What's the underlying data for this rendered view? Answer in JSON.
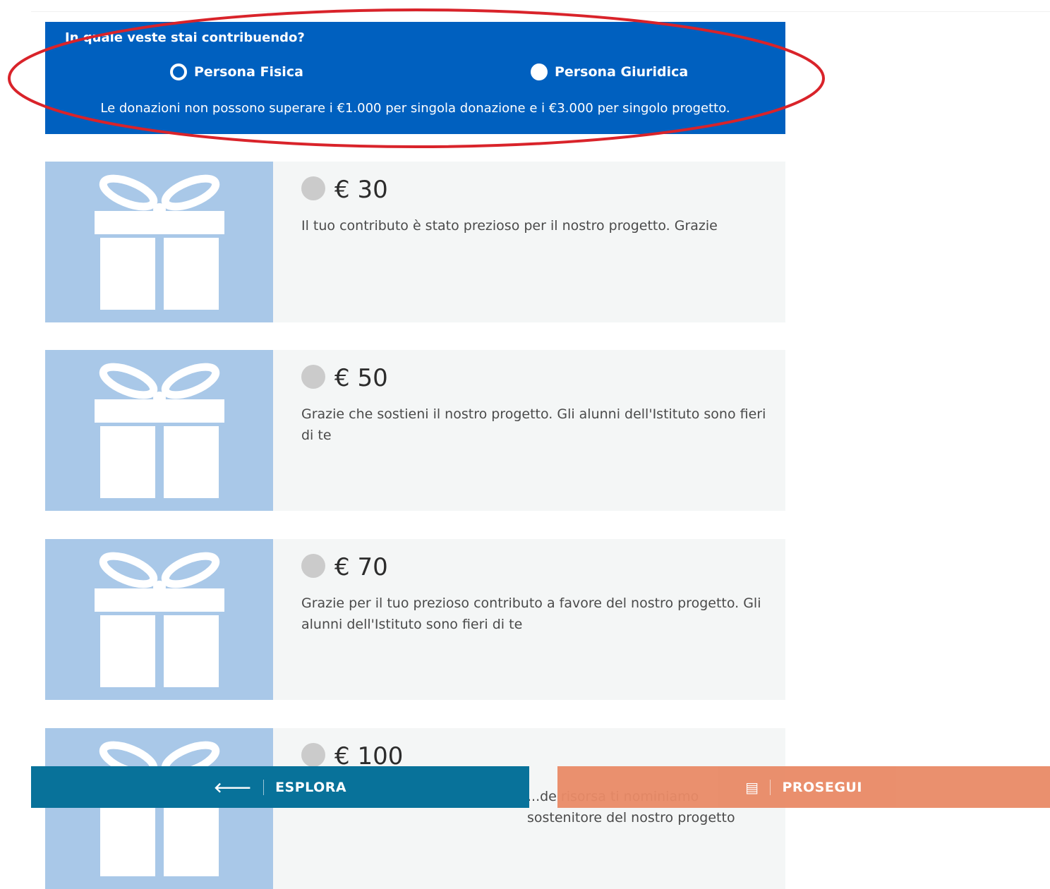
{
  "contribution": {
    "question": "In quale veste stai contribuendo?",
    "options": [
      {
        "label": "Persona Fisica",
        "selected": true
      },
      {
        "label": "Persona Giuridica",
        "selected": false
      }
    ],
    "note": "Le donazioni non possono superare i €1.000 per singola donazione e i €3.000 per singolo progetto."
  },
  "rewards": [
    {
      "amount": "€ 30",
      "description": "Il tuo contributo è stato prezioso per il nostro progetto. Grazie"
    },
    {
      "amount": "€ 50",
      "description": "Grazie che sostieni il nostro progetto. Gli alunni dell'Istituto sono fieri di te"
    },
    {
      "amount": "€ 70",
      "description": "Grazie per il tuo prezioso contributo a favore del nostro progetto. Gli alunni dell'Istituto sono fieri di te"
    },
    {
      "amount": "€ 100",
      "description": "...de risorsa ti nominiamo sostenitore del nostro progetto"
    }
  ],
  "footer": {
    "back_label": "ESPLORA",
    "back_icon": "arrow-left-icon",
    "next_label": "PROSEGUI",
    "next_icon": "id-card-icon"
  },
  "colors": {
    "header_blue": "#0060bf",
    "card_image_blue": "#a9c8e8",
    "esplora_teal": "#08729a",
    "prosegui_orange": "#e98a66",
    "highlight_red": "#d9232a"
  }
}
